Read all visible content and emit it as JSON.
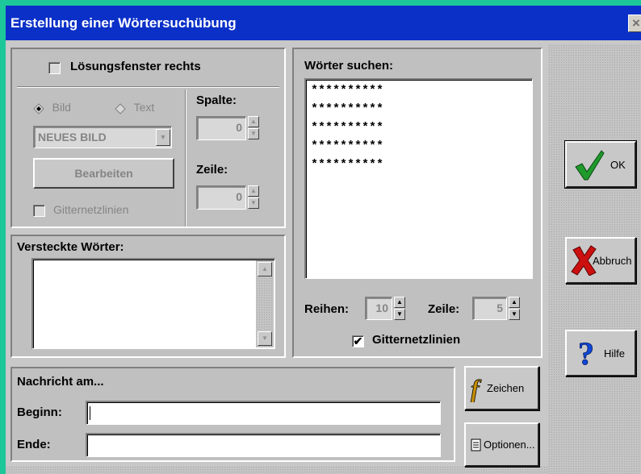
{
  "window": {
    "title": "Erstellung einer Wörtersuchübung",
    "close_glyph": "×"
  },
  "solution_pane": {
    "checkbox_label": "Lösungsfenster rechts",
    "checked": false
  },
  "image_options": {
    "radio_bild": "Bild",
    "radio_text": "Text",
    "selected": "Bild",
    "image_select_value": "NEUES BILD",
    "edit_button": "Bearbeiten",
    "gridlines_label": "Gitternetzlinien"
  },
  "spalte": {
    "label": "Spalte:",
    "value": "0"
  },
  "zeile_left": {
    "label": "Zeile:",
    "value": "0"
  },
  "hidden_words": {
    "label": "Versteckte Wörter:",
    "items": []
  },
  "search_words": {
    "label": "Wörter suchen:",
    "items": [
      "**********",
      "**********",
      "**********",
      "**********",
      "**********"
    ],
    "rows_label": "Reihen:",
    "rows_value": "10",
    "line_label": "Zeile:",
    "line_value": "5",
    "gridlines_label": "Gitternetzlinien",
    "gridlines_checked": true,
    "check_glyph": "✔"
  },
  "message": {
    "heading": "Nachricht am...",
    "begin_label": "Beginn:",
    "begin_value": "",
    "end_label": "Ende:",
    "end_value": ""
  },
  "buttons": {
    "ok": "OK",
    "cancel": "Abbruch",
    "help": "Hilfe",
    "font": "Zeichen",
    "options": "Optionen..."
  },
  "colors": {
    "title_bar": "#0b30c8",
    "ok_check": "#1f9a2b",
    "cancel_x": "#cc1010",
    "help_q": "#1048d8",
    "font_f": "#c89000"
  }
}
